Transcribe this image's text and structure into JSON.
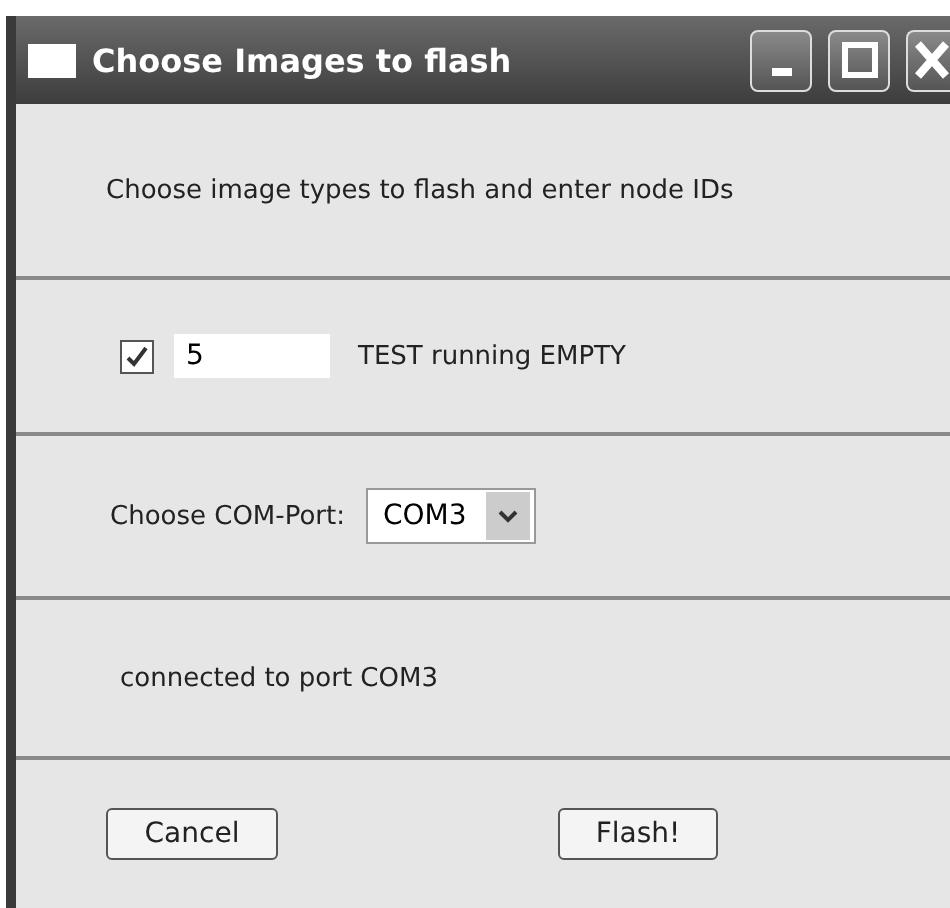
{
  "window": {
    "title": "Choose Images to flash"
  },
  "intro": "Choose image types to flash and enter node IDs",
  "images": [
    {
      "checked": true,
      "node_id": "5",
      "label": "TEST running EMPTY"
    }
  ],
  "port": {
    "label": "Choose COM-Port:",
    "value": "COM3"
  },
  "status": "connected to port COM3",
  "buttons": [
    "Cancel",
    "Flash!"
  ]
}
